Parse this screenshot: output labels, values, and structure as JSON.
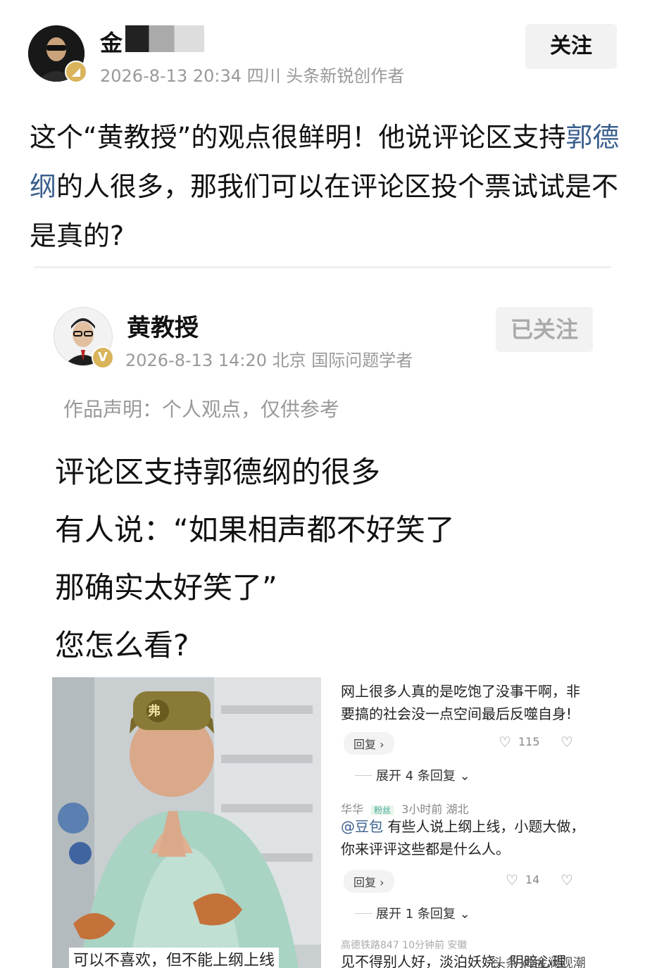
{
  "author": {
    "name": "金",
    "meta": "2026-8-13 20:34 四川 头条新锐创作者",
    "follow_label": "关注"
  },
  "post": {
    "text_before": "这个“黄教授”的观点很鲜明！他说评论区支持",
    "link_text": "郭德纲",
    "text_after": "的人很多，那我们可以在评论区投个票试试是不是真的?"
  },
  "quoted": {
    "name": "黄教授",
    "meta": "2026-8-13 14:20 北京 国际问题学者",
    "follow_label": "已关注",
    "verified_badge": "V",
    "declaration": "作品声明：个人观点，仅供参考",
    "lines": [
      "评论区支持郭德纲的很多",
      "有人说：“如果相声都不好笑了",
      "那确实太好笑了”",
      "您怎么看?"
    ],
    "image_left_caption": "可以不喜欢，但不能上纲上线",
    "image_hat_text": "弗",
    "comments": [
      {
        "text_line1": "网上很多人真的是吃饱了没事干啊，非",
        "text_line2": "要搞的社会没一点空间最后反噬自身!",
        "reply_label": "回复 ›",
        "likes": "115",
        "expand": "展开 4 条回复 ⌄"
      },
      {
        "user": "华华",
        "tag": "粉丝",
        "time": "3小时前  湖北",
        "mention": "@豆包",
        "text_line1": " 有些人说上纲上线，小题大做，",
        "text_line2": "你来评评这些都是什么人。",
        "reply_label": "回复 ›",
        "likes": "14",
        "expand": "展开 1 条回复 ⌄"
      }
    ],
    "bottom_user": "高德铁路847  10分钟前  安徽",
    "bottom_text": "见不得别人好，淡泊妖娆，阴暗心理",
    "watermark": "头条 @金澜观潮"
  },
  "colors": {
    "link": "#3a5f8e",
    "badge_gold": "#d9b45a",
    "robe": "#a9d3c3"
  },
  "icons": {
    "gold_badge": "rank-badge-icon",
    "verified": "verified-v-icon",
    "heart": "heart-icon",
    "broken_heart": "dislike-heart-icon"
  }
}
